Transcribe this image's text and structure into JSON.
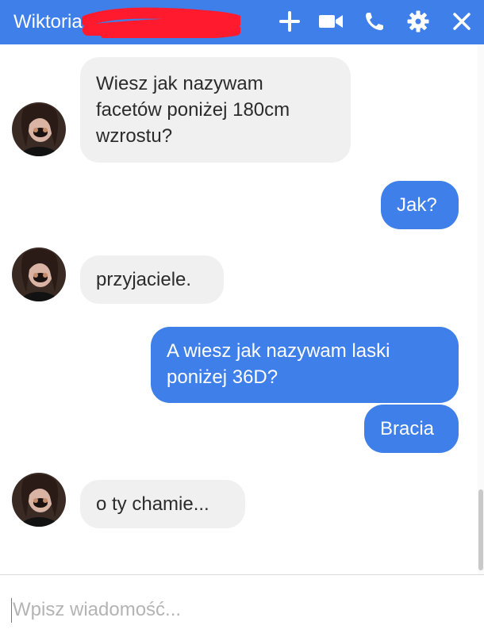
{
  "header": {
    "contact_name": "Wiktoria",
    "icons": [
      "plus-icon",
      "video-camera-icon",
      "phone-icon",
      "gear-icon",
      "close-icon"
    ]
  },
  "messages": [
    {
      "from": "contact",
      "text": "Wiesz jak nazywam\nfacetów poniżej 180cm\nwzrostu?"
    },
    {
      "from": "me",
      "text": "Jak?"
    },
    {
      "from": "contact",
      "text": "przyjaciele."
    },
    {
      "from": "me",
      "text": "A wiesz jak nazywam laski\nponiżej 36D?"
    },
    {
      "from": "me",
      "text": "Bracia"
    },
    {
      "from": "contact",
      "text": "o ty chamie..."
    }
  ],
  "composer": {
    "placeholder": "Wpisz wiadomość..."
  },
  "colors": {
    "accent": "#3f7fe9",
    "incoming_bubble": "#f1f0f0",
    "outgoing_text": "#ffffff",
    "redaction": "#ff1a2e"
  }
}
